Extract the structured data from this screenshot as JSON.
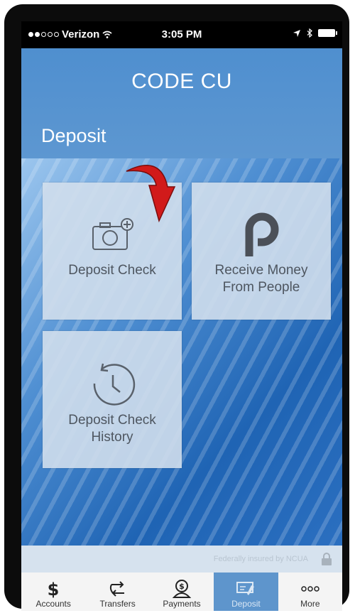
{
  "status_bar": {
    "carrier": "Verizon",
    "time": "3:05 PM"
  },
  "header": {
    "app_title": "CODE CU",
    "page_title": "Deposit"
  },
  "tiles": [
    {
      "label_line1": "Deposit Check",
      "label_line2": "",
      "icon": "camera-plus-icon"
    },
    {
      "label_line1": "Receive Money",
      "label_line2": "From People",
      "icon": "popmoney-p-icon"
    },
    {
      "label_line1": "Deposit Check",
      "label_line2": "History",
      "icon": "history-clock-icon"
    }
  ],
  "disclaimer": {
    "text": "Federally insured by NCUA"
  },
  "tab_bar": {
    "items": [
      {
        "label": "Accounts",
        "icon": "dollar-icon"
      },
      {
        "label": "Transfers",
        "icon": "transfer-arrows-icon"
      },
      {
        "label": "Payments",
        "icon": "payments-person-icon"
      },
      {
        "label": "Deposit",
        "icon": "deposit-check-icon"
      },
      {
        "label": "More",
        "icon": "more-dots-icon"
      }
    ],
    "active_index": 3
  },
  "colors": {
    "header": "#5d97d1",
    "tile": "#d0deec",
    "active_tab": "#5e95cc",
    "arrow": "#d11a1a"
  }
}
